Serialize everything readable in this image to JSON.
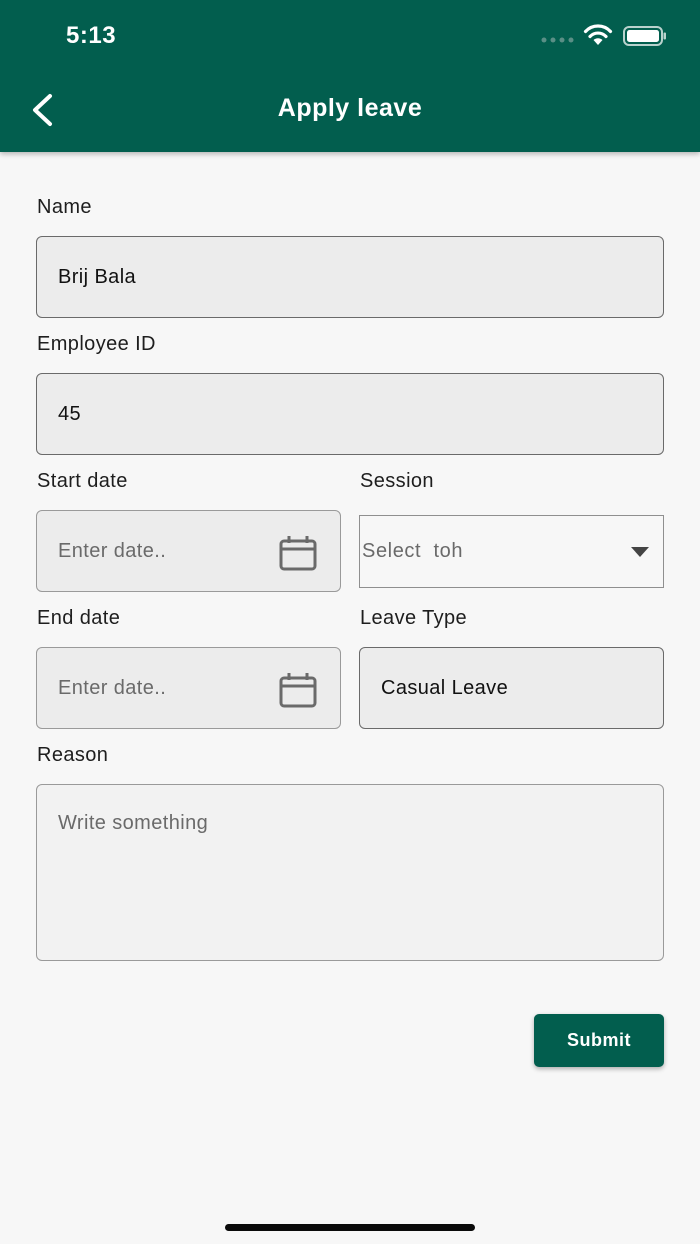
{
  "status_bar": {
    "time": "5:13"
  },
  "app_bar": {
    "title": "Apply leave",
    "back_icon": "chevron-left-icon"
  },
  "form": {
    "name": {
      "label": "Name",
      "value": "Brij Bala"
    },
    "employee_id": {
      "label": "Employee ID",
      "value": "45"
    },
    "start_date": {
      "label": "Start date",
      "placeholder": "Enter date..",
      "icon": "calendar-icon"
    },
    "session": {
      "label": "Session",
      "selected": "Select  toh",
      "icon": "caret-down-icon"
    },
    "end_date": {
      "label": "End date",
      "placeholder": "Enter date..",
      "icon": "calendar-icon"
    },
    "leave_type": {
      "label": "Leave Type",
      "value": "Casual Leave"
    },
    "reason": {
      "label": "Reason",
      "placeholder": "Write something"
    },
    "submit_label": "Submit"
  },
  "colors": {
    "primary": "#025e4e",
    "background": "#f7f7f7",
    "field_bg": "#ececec"
  }
}
